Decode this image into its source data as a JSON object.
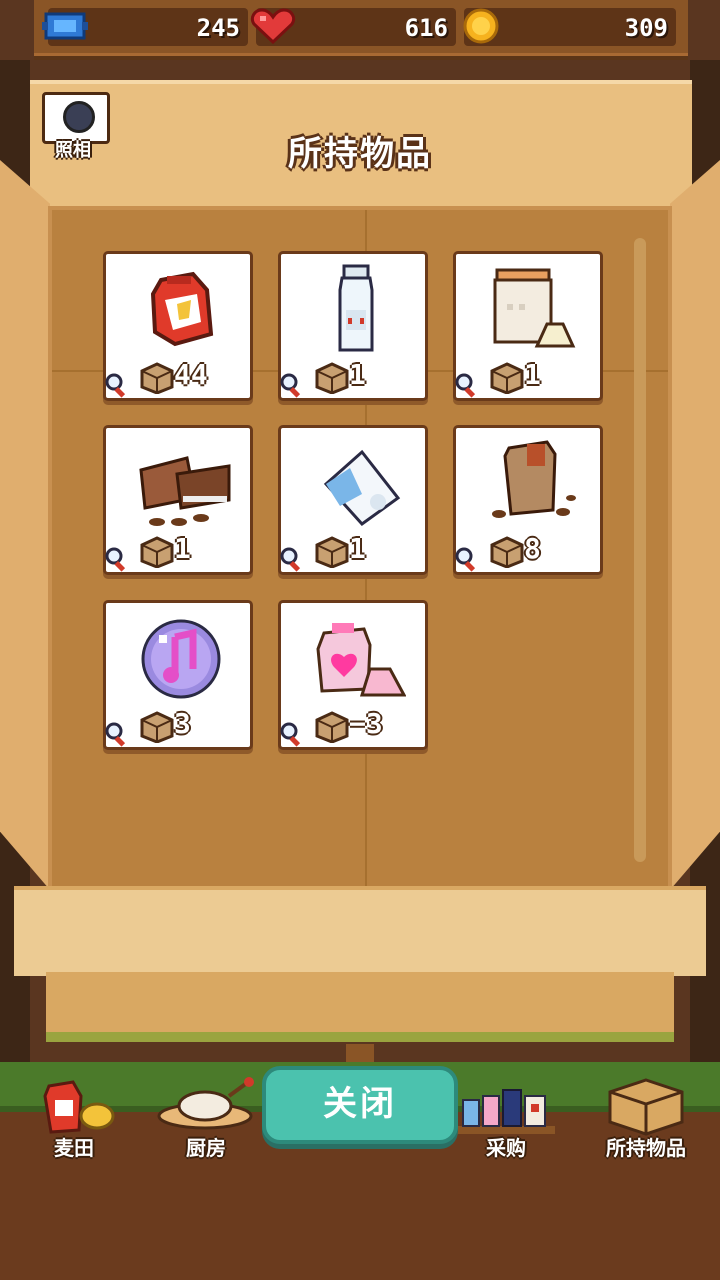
{
  "resources": {
    "tickets": "245",
    "hearts": "616",
    "coins": "309"
  },
  "camera": {
    "label": "照相",
    "icon": "camera-icon"
  },
  "title": "所持物品",
  "items": [
    {
      "name": "wheat-flour-bag",
      "count": "44"
    },
    {
      "name": "milk-bottle",
      "count": "1"
    },
    {
      "name": "sugar-jar",
      "count": "1"
    },
    {
      "name": "chocolate-bar",
      "count": "1"
    },
    {
      "name": "milk-carton",
      "count": "1"
    },
    {
      "name": "cocoa-sack",
      "count": "8"
    },
    {
      "name": "music-bubble",
      "count": "3"
    },
    {
      "name": "love-sack",
      "count": "−3"
    }
  ],
  "close_button": "关闭",
  "nav": {
    "items": [
      {
        "label": "麦田",
        "icon": "wheat-field-icon"
      },
      {
        "label": "厨房",
        "icon": "kitchen-icon"
      },
      {
        "label": "采购",
        "icon": "shop-icon"
      },
      {
        "label": "所持物品",
        "icon": "box-icon"
      }
    ]
  },
  "colors": {
    "close_button": "#4bc2ae",
    "card_border": "#6a3a1a",
    "box_inner": "#b9813f"
  }
}
